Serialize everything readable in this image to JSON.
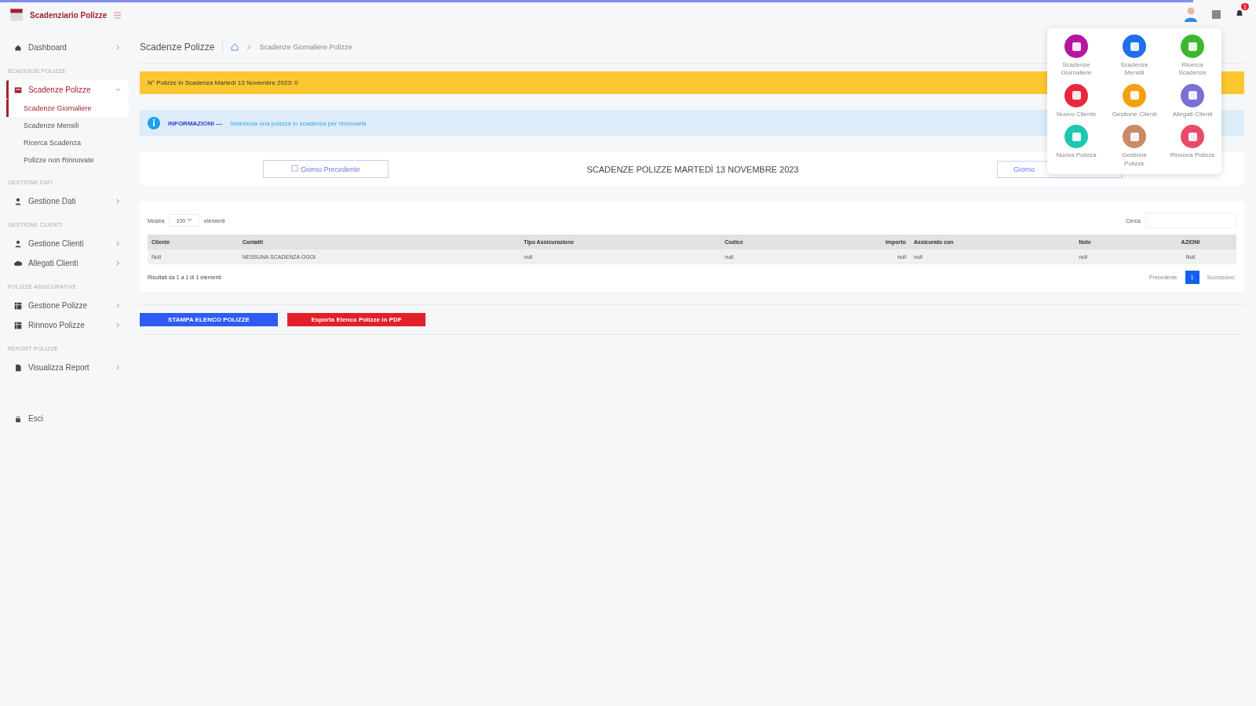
{
  "brand": {
    "title": "Scadenziario Polizze"
  },
  "sidebar": {
    "sections": [
      {
        "items": [
          {
            "label": "Dashboard",
            "selected": false,
            "expanded": false
          }
        ]
      },
      {
        "label": "SCADENZE POLIZZE",
        "items": [
          {
            "label": "Scadenze Polizze",
            "selected": true,
            "expanded": true,
            "children": [
              {
                "label": "Scadenze Giornaliere",
                "selected": true
              },
              {
                "label": "Scadenze Mensili",
                "selected": false
              },
              {
                "label": "Ricerca Scadenza",
                "selected": false
              },
              {
                "label": "Polizze non Rinnovate",
                "selected": false
              }
            ]
          }
        ]
      },
      {
        "label": "GESTIONE DATI",
        "items": [
          {
            "label": "Gestione Dati",
            "selected": false,
            "expanded": false
          }
        ]
      },
      {
        "label": "GESTIONE CLIENTI",
        "items": [
          {
            "label": "Gestione Clienti",
            "selected": false,
            "expanded": false
          },
          {
            "label": "Allegati Clienti",
            "selected": false,
            "expanded": false
          }
        ]
      },
      {
        "label": "POLIZZE ASSICURATIVE",
        "items": [
          {
            "label": "Gestione Polizze",
            "selected": false,
            "expanded": false
          },
          {
            "label": "Rinnovo Polizze",
            "selected": false,
            "expanded": false
          }
        ]
      },
      {
        "label": "REPORT POLIZZE",
        "items": [
          {
            "label": "Visualizza Report",
            "selected": false,
            "expanded": false
          }
        ]
      },
      {
        "items": [
          {
            "label": "Esci",
            "selected": false
          }
        ]
      }
    ]
  },
  "header": {
    "notification_count": "1"
  },
  "breadcrumb": {
    "title": "Scadenze Polizze",
    "current": "Scadenze Giornaliere Polizze"
  },
  "alert": {
    "text": "N° Polizze in Scadenza Martedì 13 Novembre 2023: 0"
  },
  "info": {
    "title": "INFORMAZIONI —",
    "text": "Seleziona una polizza in scadenza per rinnovarla"
  },
  "day_nav": {
    "prev": "Giorno Precedente",
    "title": "SCADENZE POLIZZE MARTEDÌ 13 NOVEMBRE 2023",
    "next": "Giorno"
  },
  "table": {
    "show_label": "Mostra",
    "page_size": "100",
    "show_suffix": "elementi",
    "search_label": "Cerca",
    "columns": [
      "Cliente",
      "Contatti",
      "Tipo Assicurazione",
      "Codice",
      "Importo",
      "Assicurato con",
      "Note",
      "AZIONI"
    ],
    "rows": [
      [
        "Null",
        "NESSUNA SCADENZA OGGI",
        "null",
        "null",
        "null",
        "null",
        "null",
        "Null"
      ]
    ],
    "info": "Risultati da 1 a 1 di 1 elementi",
    "pagination": [
      {
        "label": "Precedente",
        "selected": false
      },
      {
        "label": "1",
        "selected": true
      },
      {
        "label": "Successivo",
        "selected": false
      }
    ]
  },
  "actions": [
    {
      "label": "STAMPA ELENCO POLIZZE",
      "color": "#2f5bf5"
    },
    {
      "label": "Esporta Elenco Polizze in PDF",
      "color": "#e3202a"
    }
  ],
  "apps_menu": [
    {
      "label": "Scadenze Giornaliere",
      "color": "#b5179e"
    },
    {
      "label": "Scadenze Mensili",
      "color": "#1e6fe8"
    },
    {
      "label": "Ricerca Scadenze",
      "color": "#3cb82f"
    },
    {
      "label": "Nuovo Cliente",
      "color": "#e8283c"
    },
    {
      "label": "Gestione Clienti",
      "color": "#f4a015"
    },
    {
      "label": "Allegati Clienti",
      "color": "#7a6fd6"
    },
    {
      "label": "Nuova Polizza",
      "color": "#1ec8b0"
    },
    {
      "label": "Gestione Polizze",
      "color": "#c98a65"
    },
    {
      "label": "Rinnova Polizze",
      "color": "#e84a6a"
    }
  ]
}
